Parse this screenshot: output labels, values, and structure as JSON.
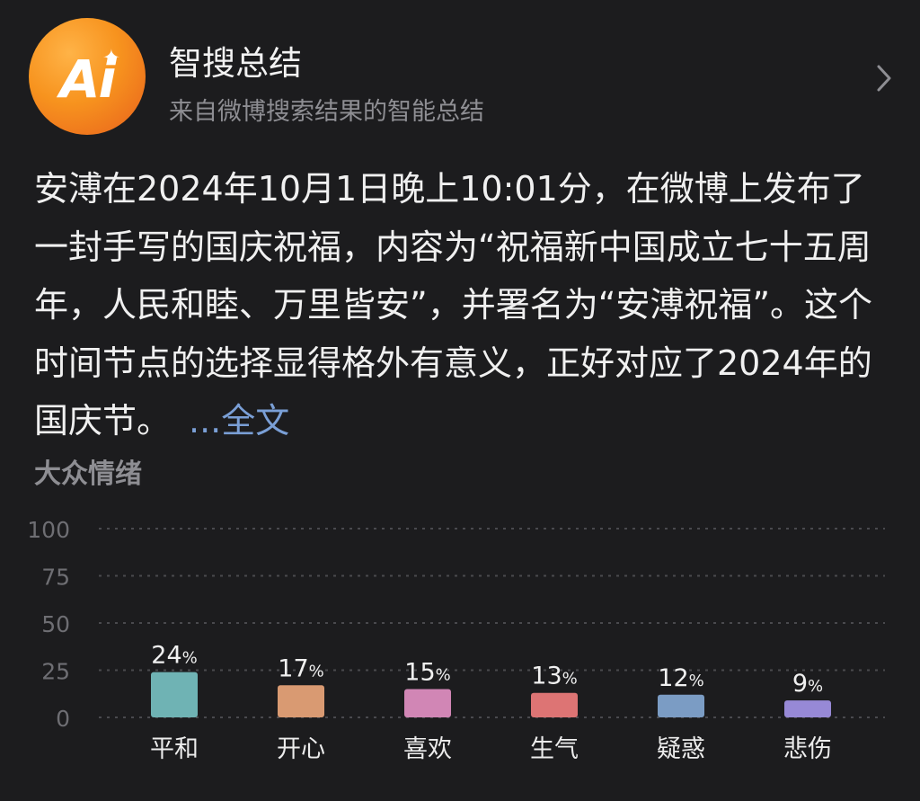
{
  "header": {
    "logo_text": "Ai",
    "title": "智搜总结",
    "subtitle": "来自微博搜索结果的智能总结"
  },
  "summary": {
    "text": "安溥在2024年10月1日晚上10:01分，在微博上发布了一封手写的国庆祝福，内容为“祝福新中国成立七十五周年，人民和睦、万里皆安”，并署名为“安溥祝福”。这个时间节点的选择显得格外有意义，正好对应了2024年的国庆节。",
    "more_label": "...全文"
  },
  "sentiment_section": {
    "title": "大众情绪"
  },
  "chart_data": {
    "type": "bar",
    "categories": [
      "平和",
      "开心",
      "喜欢",
      "生气",
      "疑惑",
      "悲伤"
    ],
    "values": [
      24,
      17,
      15,
      13,
      12,
      9
    ],
    "value_suffix": "%",
    "ylim": [
      0,
      100
    ],
    "yticks": [
      0,
      25,
      50,
      75,
      100
    ],
    "grid": true,
    "colors": [
      "#6fb3b4",
      "#d99a72",
      "#d186b5",
      "#dd7474",
      "#7b9cc4",
      "#9789d6"
    ]
  },
  "colors": {
    "background": "#1c1c1e",
    "link": "#7a9fd6",
    "muted": "#8e8e93",
    "logo_orange": "#f7931e"
  }
}
